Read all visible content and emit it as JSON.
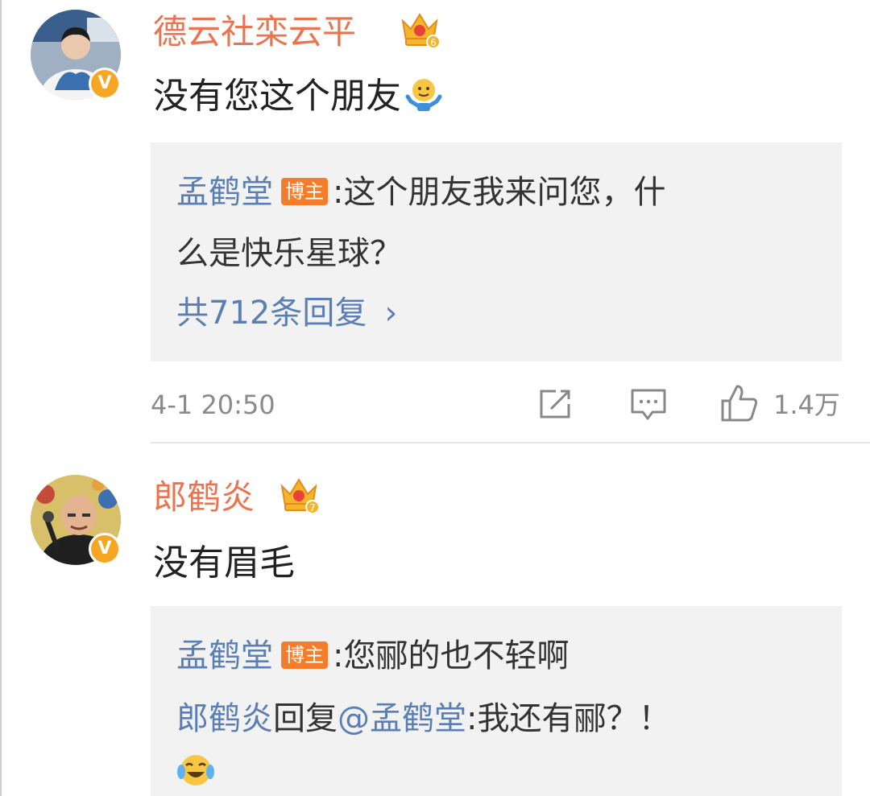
{
  "comments": [
    {
      "username": "德云社栾云平",
      "level_badge": "6",
      "verified_badge": "V",
      "text": "没有您这个朋友",
      "reply": {
        "author": "孟鹤堂",
        "author_tag": "博主",
        "colon": ":",
        "line1": "这个朋友我来问您，什",
        "line2": "么是快乐星球？",
        "more_replies": "共712条回复",
        "chevron": "›"
      },
      "timestamp": "4-1 20:50",
      "like_count": "1.4万"
    },
    {
      "username": "郎鹤炎",
      "level_badge": "7",
      "verified_badge": "V",
      "text": "没有眉毛",
      "reply": {
        "author": "孟鹤堂",
        "author_tag": "博主",
        "colon": ":",
        "line1": "您郦的也不轻啊",
        "sub_author": "郎鹤炎",
        "sub_reply_word": "回复",
        "sub_mention": "@孟鹤堂",
        "sub_text": ":我还有郦？！"
      }
    }
  ],
  "icons": [
    "crown-icon",
    "shrug-emoji-icon",
    "laughing-tears-emoji-icon",
    "repost-icon",
    "comment-icon",
    "like-icon",
    "verified-icon"
  ],
  "colors": {
    "username": "#eb7350",
    "link_blue": "#5a7fb5",
    "tag_orange": "#f57c2a",
    "reply_bg": "#f2f2f2",
    "meta_gray": "#8a8a8a"
  }
}
